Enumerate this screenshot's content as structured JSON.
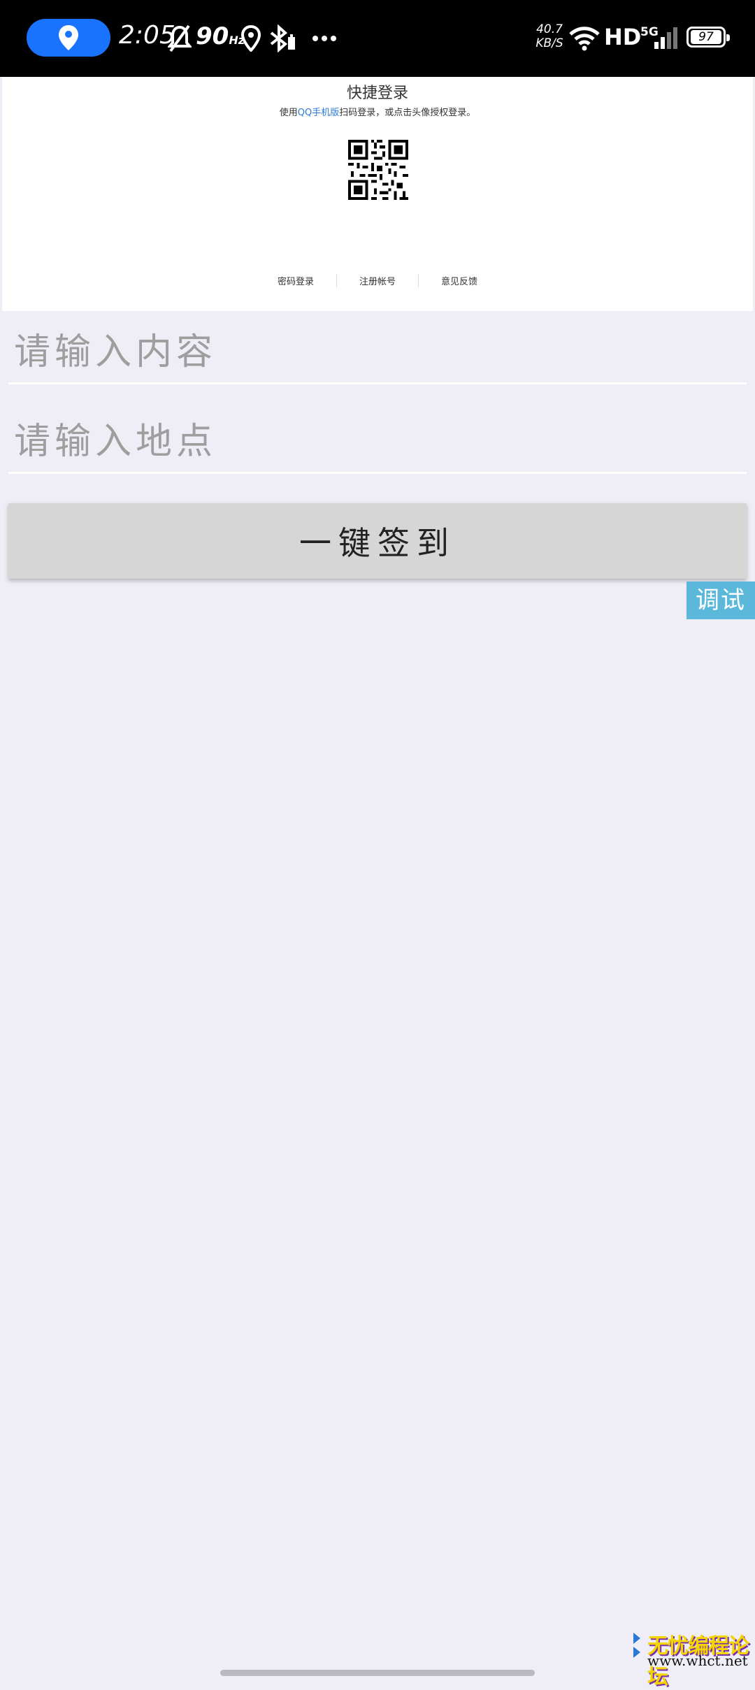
{
  "status_bar": {
    "time": "2:05",
    "refresh_rate": "90",
    "refresh_unit": "Hz",
    "net_speed_value": "40.7",
    "net_speed_unit": "KB/S",
    "hd": "HD",
    "network": "5G",
    "battery": "97"
  },
  "login_panel": {
    "title": "快捷登录",
    "desc_prefix": "使用",
    "desc_link": "QQ手机版",
    "desc_suffix": "扫码登录，或点击头像授权登录。",
    "links": [
      "密码登录",
      "注册帐号",
      "意见反馈"
    ]
  },
  "form": {
    "content_placeholder": "请输入内容",
    "location_placeholder": "请输入地点",
    "signin_label": "一键签到",
    "debug_label": "调试"
  },
  "watermark": {
    "title": "无忧编程论坛",
    "url": "www.whct.net"
  },
  "colors": {
    "page_bg": "#efeef6",
    "status_bg": "#000000",
    "pill_blue": "#1a73ff",
    "button_bg": "#d6d6d6",
    "debug_bg": "#5bb8db",
    "link_blue": "#2b78d8"
  },
  "icons": [
    "location-pin-icon",
    "alarm-off-icon",
    "location-icon",
    "bluetooth-icon",
    "more-icon",
    "wifi-icon",
    "signal-icon",
    "qr-code-icon"
  ]
}
